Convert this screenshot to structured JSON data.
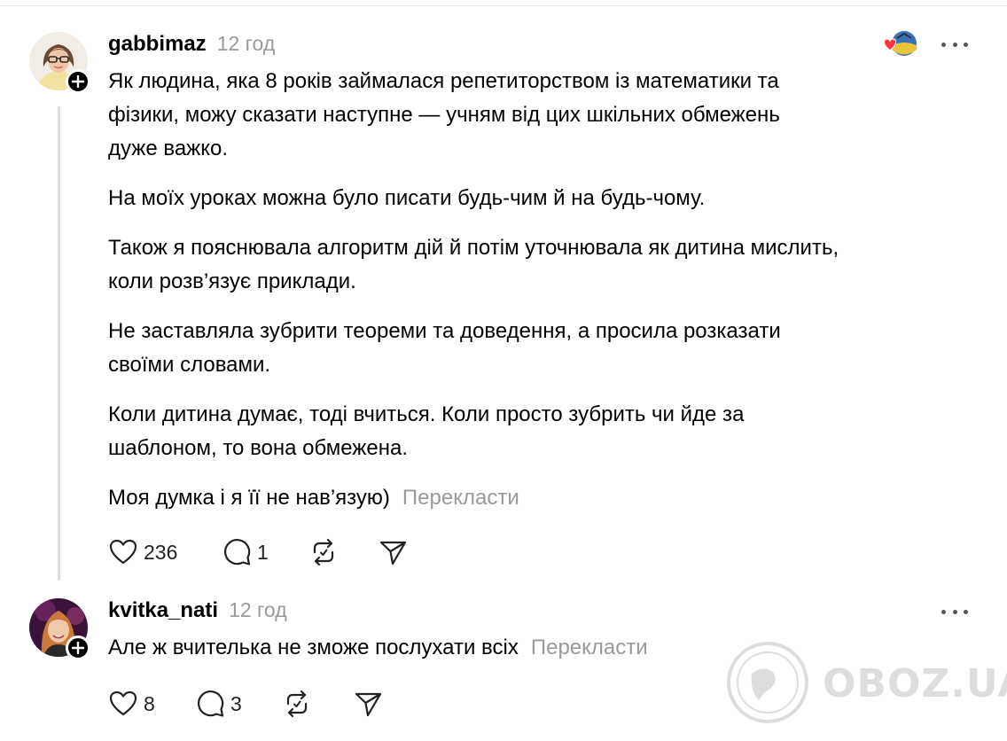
{
  "posts": [
    {
      "username": "gabbimaz",
      "time": "12 год",
      "paragraphs": [
        "Як людина, яка 8 років займалася репетиторством із математики та\nфізики, можу сказати наступне — учням від цих шкільних обмежень\nдуже важко.",
        "На моїх уроках можна було писати будь-чим й на будь-чому.",
        "Також я пояснювала алгоритм дій й потім уточнювала як дитина мислить,\nколи розв’язує приклади.",
        "Не заставляла зубрити теореми та доведення, а просила розказати\nсвоїми словами.",
        "Коли дитина думає, тоді вчиться. Коли просто зубрить чи йде за\nшаблоном, то вона обмежена."
      ],
      "last_line": "Моя думка і я її не нав’язую)",
      "translate_label": "Перекласти",
      "likes": "236",
      "replies": "1"
    },
    {
      "username": "kvitka_nati",
      "time": "12 год",
      "last_line": "Але ж вчителька не зможе послухати всіх",
      "translate_label": "Перекласти",
      "likes": "8",
      "replies": "3"
    }
  ],
  "watermark": {
    "text": "OBOZ.UA"
  },
  "icons": {
    "like": "heart-outline-icon",
    "reply": "speech-bubble-icon",
    "repost": "repost-arrows-icon",
    "share": "paper-plane-icon",
    "more": "more-dots-icon",
    "follow": "plus-icon"
  },
  "colors": {
    "text": "#000000",
    "muted": "#9a9a9a",
    "thread_line": "#dcdcdc",
    "liked_heart": "#ff3040"
  }
}
